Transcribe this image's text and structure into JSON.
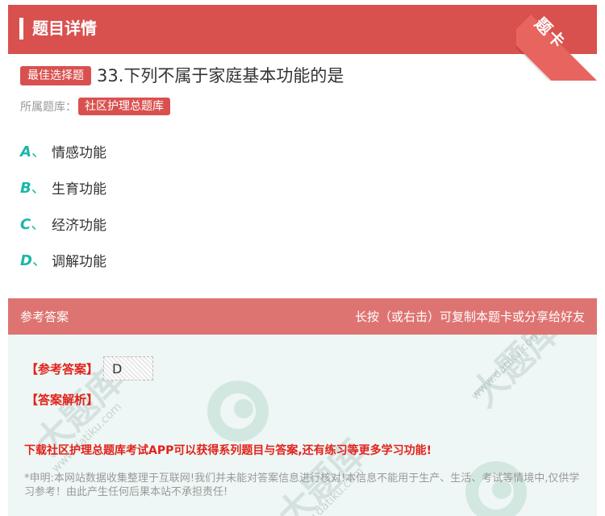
{
  "header": {
    "title": "题目详情",
    "corner_label": "题卡"
  },
  "question": {
    "type_badge": "最佳选择题",
    "text": "33.下列不属于家庭基本功能的是",
    "bank_label": "所属题库：",
    "bank_name": "社区护理总题库"
  },
  "options": [
    {
      "letter": "A",
      "sep": "、",
      "text": "情感功能"
    },
    {
      "letter": "B",
      "sep": "、",
      "text": "生育功能"
    },
    {
      "letter": "C",
      "sep": "、",
      "text": "经济功能"
    },
    {
      "letter": "D",
      "sep": "、",
      "text": "调解功能"
    }
  ],
  "answer_section": {
    "label": "参考答案",
    "hint": "长按（或右击）可复制本题卡或分享给好友",
    "ref_answer_label": "【参考答案】",
    "ref_answer_value": "D",
    "analysis_label": "【答案解析】",
    "promo": "下载社区护理总题库考试APP可以获得系列题目与答案,还有练习等更多学习功能!",
    "disclaimer": "*申明:本网站数据收集整理于互联网!我们并未能对答案信息进行核对!本信息不能用于生产、生活、考试等情境中,仅供学习参考！由此产生任何后果本站不承担责任!"
  },
  "watermark": {
    "brand": "大题库",
    "url": "www.datiku.com"
  },
  "colors": {
    "primary_red": "#d9514f",
    "answer_header": "#de7472",
    "option_letter": "#1ab7a8",
    "answer_bg": "#eef7f5",
    "alert_red": "#e2221b"
  }
}
